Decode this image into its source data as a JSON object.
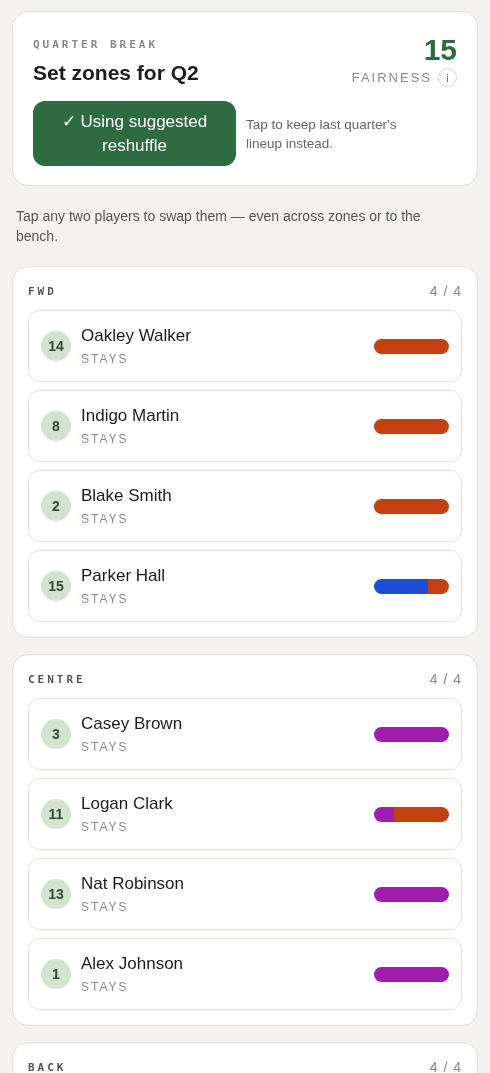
{
  "header": {
    "eyebrow": "QUARTER BREAK",
    "title": "Set zones for Q2",
    "score": "15",
    "score_label": "FAIRNESS",
    "info_icon": "i",
    "toggle": {
      "label": "✓ Using suggested reshuffle",
      "on": true
    },
    "hint": "Tap to keep last quarter's lineup instead."
  },
  "instruction": "Tap any two players to swap them — even across zones or to the bench.",
  "zones": [
    {
      "name": "FWD",
      "count": "4 / 4",
      "players": [
        {
          "number": "14",
          "name": "Oakley Walker",
          "status": "STAYS",
          "segments": [
            {
              "color": "#c2410c",
              "level": 1
            }
          ]
        },
        {
          "number": "8",
          "name": "Indigo Martin",
          "status": "STAYS",
          "segments": [
            {
              "color": "#c2410c",
              "level": 1
            }
          ]
        },
        {
          "number": "2",
          "name": "Blake Smith",
          "status": "STAYS",
          "segments": [
            {
              "color": "#c2410c",
              "level": 1
            }
          ]
        },
        {
          "number": "15",
          "name": "Parker Hall",
          "status": "STAYS",
          "segments": [
            {
              "color": "#1d4ed8",
              "level": 0.72
            },
            {
              "color": "#c2410c",
              "level": 0.28
            }
          ]
        }
      ]
    },
    {
      "name": "CENTRE",
      "count": "4 / 4",
      "players": [
        {
          "number": "3",
          "name": "Casey Brown",
          "status": "STAYS",
          "segments": [
            {
              "color": "#a21caf",
              "level": 1
            }
          ]
        },
        {
          "number": "11",
          "name": "Logan Clark",
          "status": "STAYS",
          "segments": [
            {
              "color": "#a21caf",
              "level": 0.27
            },
            {
              "color": "#c2410c",
              "level": 0.73
            }
          ]
        },
        {
          "number": "13",
          "name": "Nat Robinson",
          "status": "STAYS",
          "segments": [
            {
              "color": "#a21caf",
              "level": 1
            }
          ]
        },
        {
          "number": "1",
          "name": "Alex Johnson",
          "status": "STAYS",
          "segments": [
            {
              "color": "#a21caf",
              "level": 1
            }
          ]
        }
      ]
    },
    {
      "name": "BACK",
      "count": "4 / 4"
    }
  ]
}
